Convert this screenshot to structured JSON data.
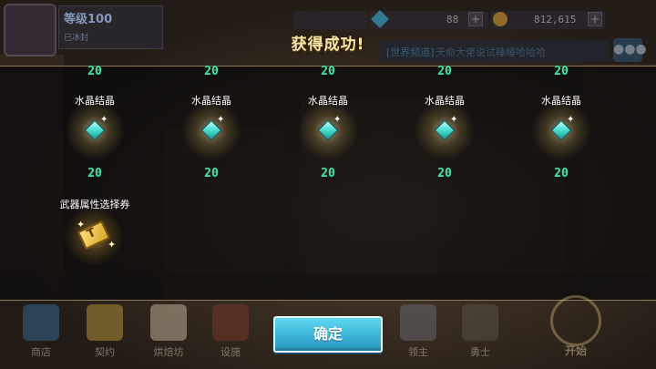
{
  "title": "获得成功!",
  "hud": {
    "level": "等级100",
    "sub": "已冰封",
    "gems": "88",
    "coins": "812,615",
    "chat_prefix": "[世界频道]",
    "chat_text": "天命大佬说试睡睡哈哈哈",
    "plus": "+"
  },
  "rewards": {
    "top_counts": [
      "20",
      "20",
      "20",
      "20",
      "20"
    ],
    "crystals": [
      {
        "name": "水晶结晶",
        "count": "20"
      },
      {
        "name": "水晶结晶",
        "count": "20"
      },
      {
        "name": "水晶结晶",
        "count": "20"
      },
      {
        "name": "水晶结晶",
        "count": "20"
      },
      {
        "name": "水晶结晶",
        "count": "20"
      }
    ],
    "ticket": {
      "name": "武器属性选择券"
    }
  },
  "nav": [
    "商店",
    "契约",
    "烘焙坊",
    "设施",
    "领主",
    "勇士"
  ],
  "start_label": "开始",
  "confirm_label": "确定",
  "colors": {
    "count_green": "#43e6a3",
    "confirm_blue": "#3bb4d8",
    "title_gold": "#f4e6a8"
  }
}
